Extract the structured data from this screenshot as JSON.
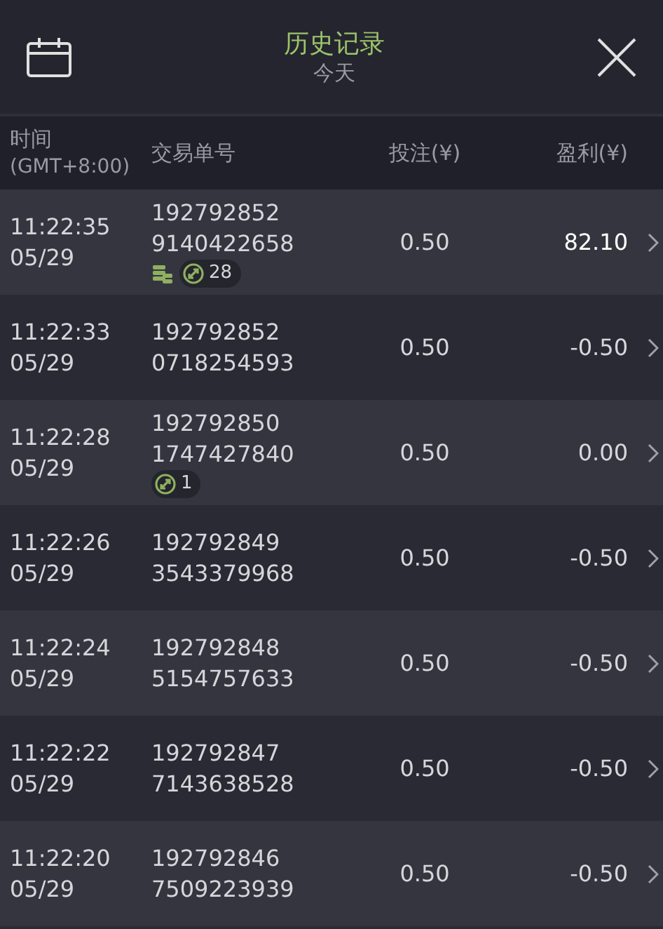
{
  "header": {
    "title": "历史记录",
    "subtitle": "今天"
  },
  "columns": [
    {
      "line1": "时间",
      "line2": "(GMT+8:00)"
    },
    {
      "line1": "交易单号"
    },
    {
      "line1": "投注(¥)"
    },
    {
      "line1": "盈利(¥)"
    }
  ],
  "rows": [
    {
      "time": "11:22:35",
      "date": "05/29",
      "order_1": "192792852",
      "order_2": "9140422658",
      "badges": [
        {
          "kind": "coins"
        },
        {
          "kind": "count",
          "text": "28"
        }
      ],
      "stake": "0.50",
      "profit": "82.10",
      "win": true
    },
    {
      "time": "11:22:33",
      "date": "05/29",
      "order_1": "192792852",
      "order_2": "0718254593",
      "badges": [],
      "stake": "0.50",
      "profit": "-0.50",
      "win": false
    },
    {
      "time": "11:22:28",
      "date": "05/29",
      "order_1": "192792850",
      "order_2": "1747427840",
      "badges": [
        {
          "kind": "count",
          "text": "1"
        }
      ],
      "stake": "0.50",
      "profit": "0.00",
      "win": false
    },
    {
      "time": "11:22:26",
      "date": "05/29",
      "order_1": "192792849",
      "order_2": "3543379968",
      "badges": [],
      "stake": "0.50",
      "profit": "-0.50",
      "win": false
    },
    {
      "time": "11:22:24",
      "date": "05/29",
      "order_1": "192792848",
      "order_2": "5154757633",
      "badges": [],
      "stake": "0.50",
      "profit": "-0.50",
      "win": false
    },
    {
      "time": "11:22:22",
      "date": "05/29",
      "order_1": "192792847",
      "order_2": "7143638528",
      "badges": [],
      "stake": "0.50",
      "profit": "-0.50",
      "win": false
    },
    {
      "time": "11:22:20",
      "date": "05/29",
      "order_1": "192792846",
      "order_2": "7509223939",
      "badges": [],
      "stake": "0.50",
      "profit": "-0.50",
      "win": false
    }
  ]
}
